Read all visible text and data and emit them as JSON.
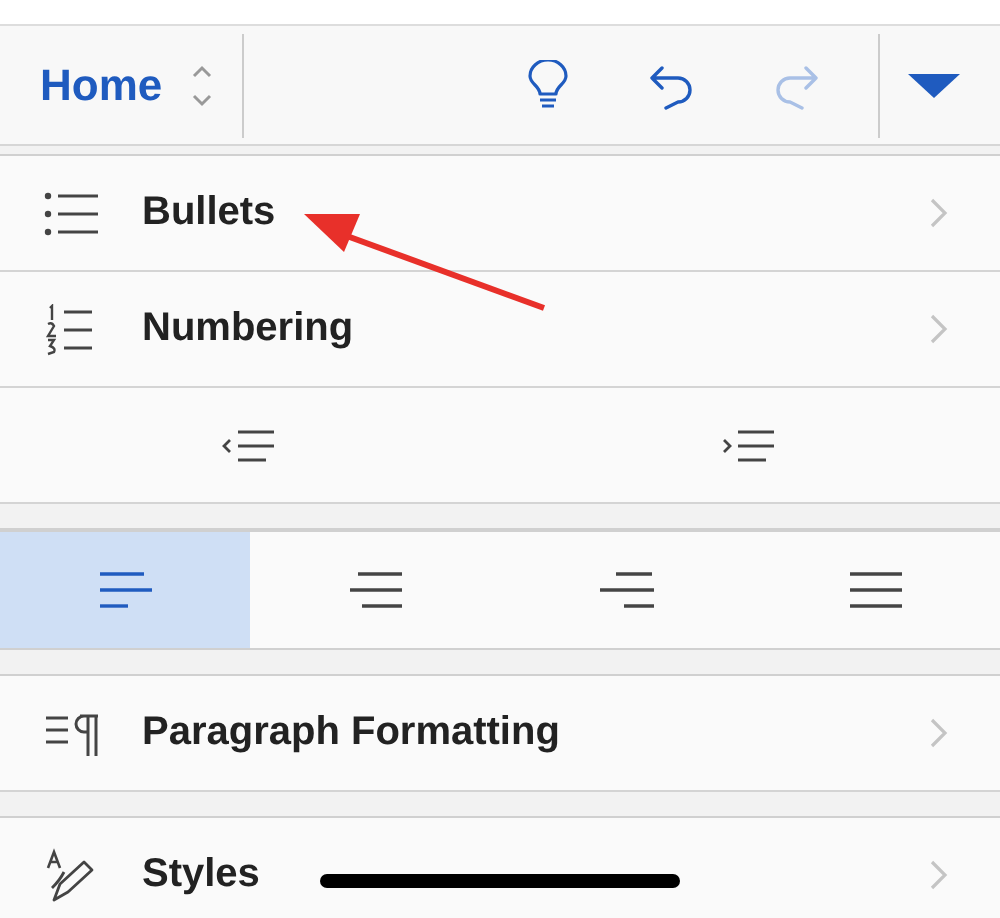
{
  "toolbar": {
    "tab_title": "Home",
    "undo": {
      "disabled": false
    },
    "redo": {
      "disabled": true
    }
  },
  "menu_top": [
    {
      "label": "Bullets"
    },
    {
      "label": "Numbering"
    }
  ],
  "alignments": [
    {
      "selected": true
    },
    {
      "selected": false
    },
    {
      "selected": false
    },
    {
      "selected": false
    }
  ],
  "menu_bottom": [
    {
      "label": "Paragraph Formatting"
    },
    {
      "label": "Styles"
    }
  ]
}
